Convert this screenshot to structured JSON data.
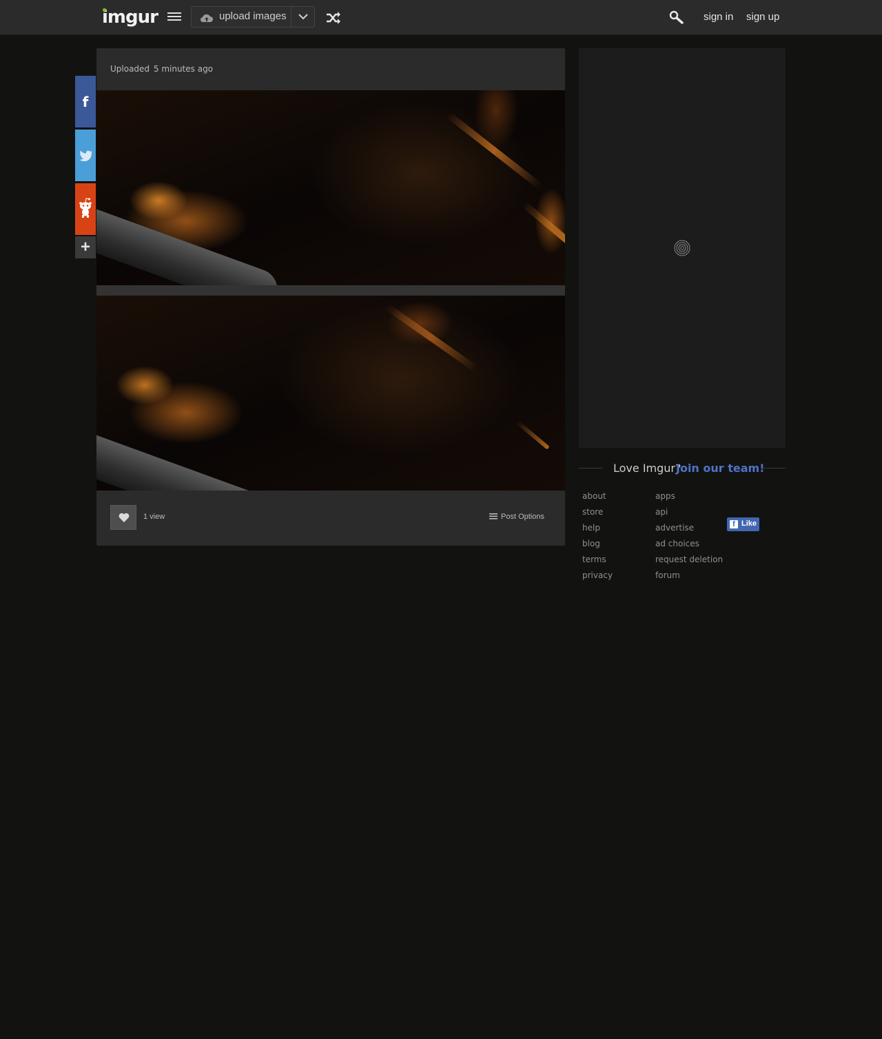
{
  "header": {
    "logo": "imgur",
    "upload_label": "upload images",
    "sign_in": "sign in",
    "sign_up": "sign up"
  },
  "share": {
    "facebook": "f",
    "more": "+"
  },
  "post": {
    "uploaded_label": "Uploaded",
    "uploaded_time": "5 minutes ago",
    "views": "1 view",
    "post_options": "Post Options",
    "images": [
      {
        "description": ""
      },
      {
        "description": ""
      }
    ]
  },
  "sidebar": {
    "love_text": "Love Imgur?",
    "join_text": "Join our team!",
    "links_col1": [
      "about",
      "store",
      "help",
      "blog",
      "terms",
      "privacy"
    ],
    "links_col2": [
      "apps",
      "api",
      "advertise",
      "ad choices",
      "request deletion",
      "forum"
    ],
    "fb_like": "Like"
  },
  "icons": {
    "menu": "hamburger-icon",
    "upload": "cloud-upload-icon",
    "dropdown": "chevron-down-icon",
    "random": "shuffle-icon",
    "search": "search-icon",
    "facebook": "facebook-icon",
    "twitter": "twitter-icon",
    "reddit": "reddit-icon",
    "more": "plus-icon",
    "favorite": "heart-icon",
    "options": "list-icon",
    "spinner": "loading-spinner-icon"
  },
  "colors": {
    "background": "#121211",
    "topbar": "#2b2b2b",
    "post_bg": "#2b2b2b",
    "accent_green": "#85bf25",
    "join_link": "#4f73c6",
    "facebook": "#3b5998",
    "twitter": "#4a9fd8",
    "reddit": "#d84315"
  }
}
